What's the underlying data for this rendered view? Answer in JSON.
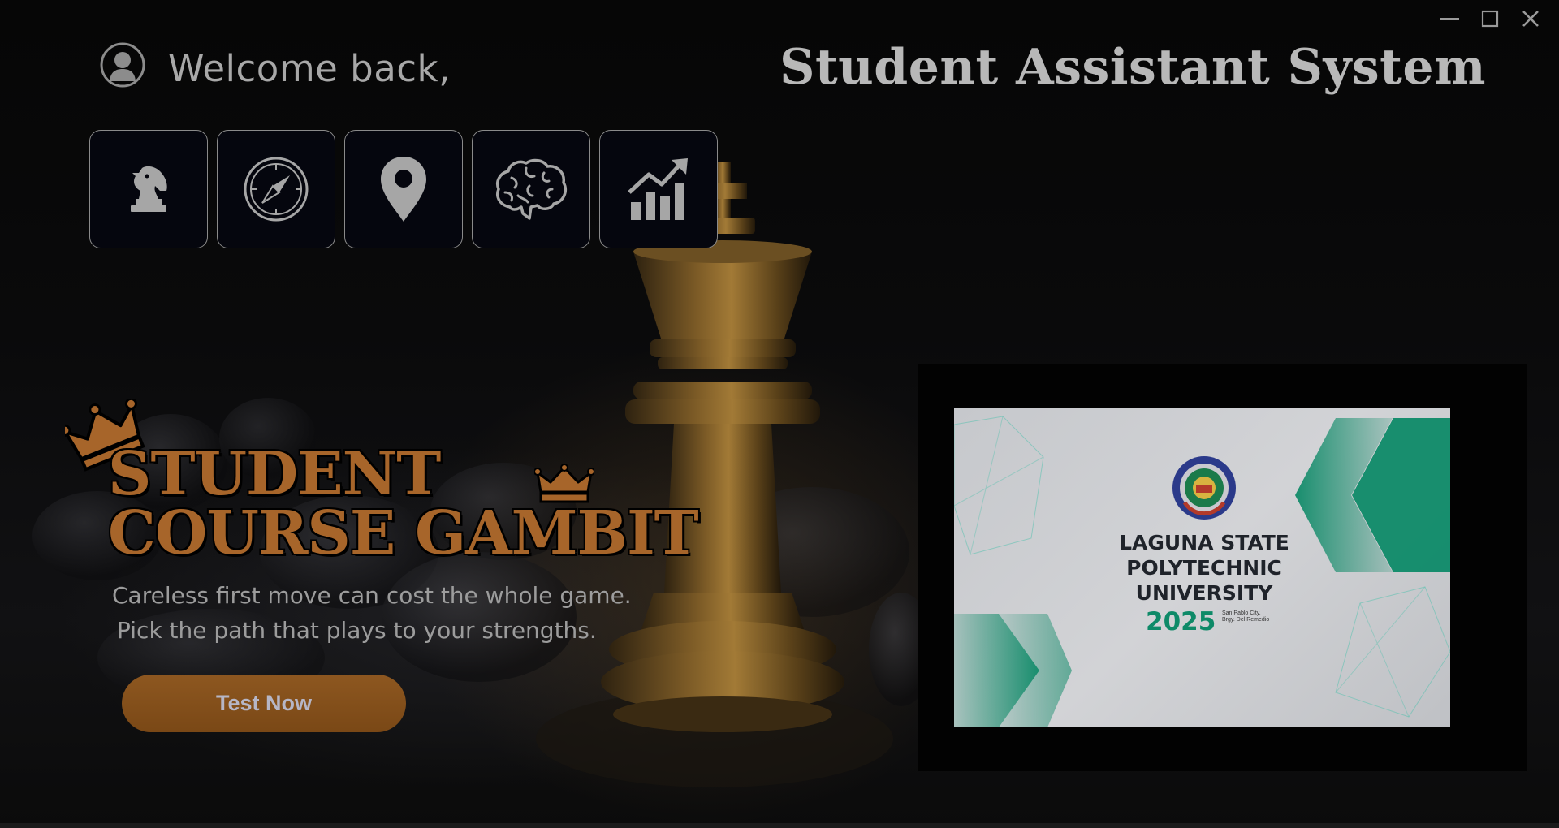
{
  "window": {
    "controls": [
      "minimize-icon",
      "maximize-icon",
      "close-icon"
    ]
  },
  "header": {
    "welcome": "Welcome back,",
    "app_title": "Student Assistant System",
    "avatar_icon": "user-avatar-icon"
  },
  "nav": {
    "items": [
      {
        "icon": "chess-knight-icon"
      },
      {
        "icon": "compass-icon"
      },
      {
        "icon": "map-pin-icon"
      },
      {
        "icon": "brain-icon"
      },
      {
        "icon": "growth-chart-icon"
      }
    ]
  },
  "hero": {
    "title_line1": "STUDENT",
    "title_line2": "COURSE GAMBIT",
    "tagline_line1": "Careless first move can cost the whole game.",
    "tagline_line2": "Pick the path that plays to your strengths.",
    "cta_label": "Test Now"
  },
  "promo": {
    "university_name": "LAGUNA STATE POLYTECHNIC UNIVERSITY",
    "year": "2025",
    "address_line1": "San Pablo City,",
    "address_line2": "Brgy. Del Remedio"
  },
  "colors": {
    "accent_bronze": "#a7652a",
    "button_bronze": "#8d5720",
    "promo_green": "#0e8a68",
    "nav_bg": "#05060e"
  }
}
